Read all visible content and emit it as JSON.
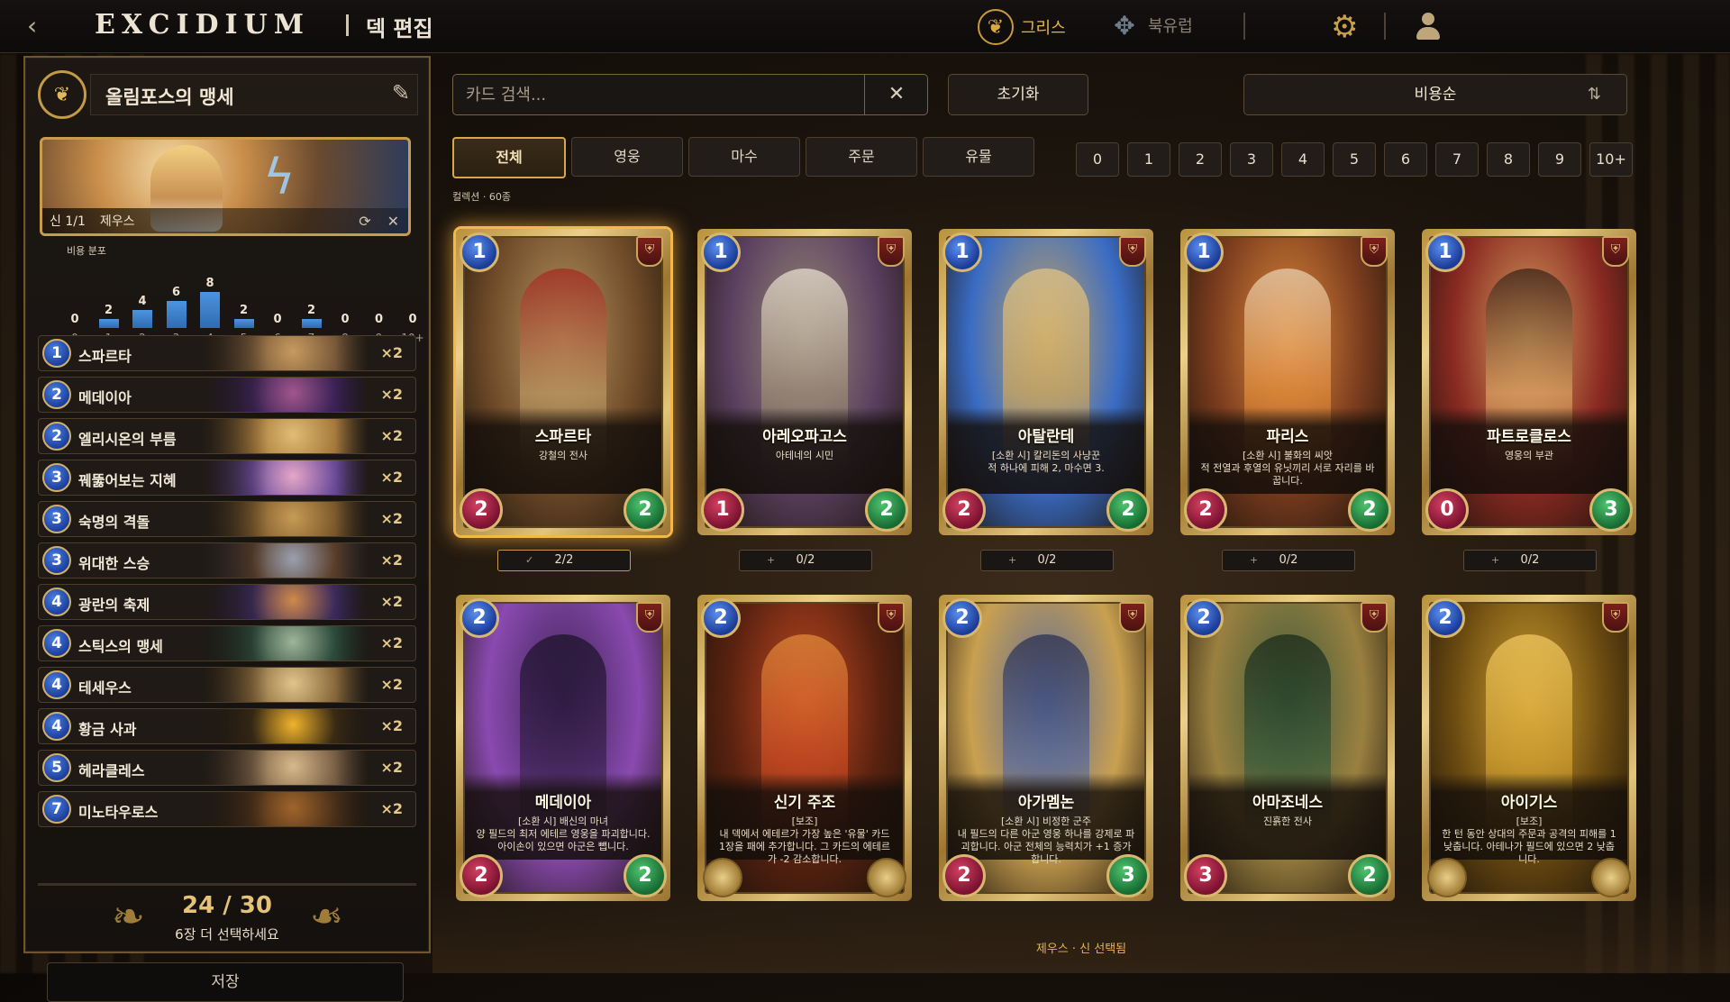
{
  "topbar": {
    "logo": "EXCIDIUM",
    "page_title": "덱 편집",
    "factions": [
      {
        "label": "그리스",
        "active": true,
        "color": "#e8b547"
      },
      {
        "label": "북유럽",
        "active": false,
        "color": "#8b8174"
      }
    ]
  },
  "deck": {
    "name": "올림포스의 맹세",
    "hero": {
      "slot": "신 1/1",
      "name": "제우스"
    },
    "cost_distribution_label": "비용 분포",
    "cost_curve": [
      {
        "cost": "0",
        "count": 0
      },
      {
        "cost": "1",
        "count": 2
      },
      {
        "cost": "2",
        "count": 4
      },
      {
        "cost": "3",
        "count": 6
      },
      {
        "cost": "4",
        "count": 8
      },
      {
        "cost": "5",
        "count": 2
      },
      {
        "cost": "6",
        "count": 0
      },
      {
        "cost": "7",
        "count": 2
      },
      {
        "cost": "8",
        "count": 0
      },
      {
        "cost": "9",
        "count": 0
      },
      {
        "cost": "10+",
        "count": 0
      }
    ],
    "cards": [
      {
        "cost": "1",
        "name": "스파르타",
        "qty": "×2",
        "art": [
          "#7a5a3a",
          "#c79a5f",
          "#3a2a1c"
        ]
      },
      {
        "cost": "2",
        "name": "메데이아",
        "qty": "×2",
        "art": [
          "#3b2257",
          "#a0568c",
          "#1d1430"
        ]
      },
      {
        "cost": "2",
        "name": "엘리시온의 부름",
        "qty": "×2",
        "art": [
          "#a77a3c",
          "#e0bd74",
          "#4b3520"
        ]
      },
      {
        "cost": "3",
        "name": "꿰뚫어보는 지혜",
        "qty": "×2",
        "art": [
          "#6b4c9a",
          "#e6a6c8",
          "#2c1f45"
        ]
      },
      {
        "cost": "3",
        "name": "숙명의 격돌",
        "qty": "×2",
        "art": [
          "#7d5a2c",
          "#c79a55",
          "#2a1e12"
        ]
      },
      {
        "cost": "3",
        "name": "위대한 스승",
        "qty": "×2",
        "art": [
          "#5a3e2a",
          "#9aa0b0",
          "#2a2a3a"
        ]
      },
      {
        "cost": "4",
        "name": "광란의 축제",
        "qty": "×2",
        "art": [
          "#3b2a5c",
          "#d08a4a",
          "#1c1630"
        ]
      },
      {
        "cost": "4",
        "name": "스틱스의 맹세",
        "qty": "×2",
        "art": [
          "#2c4a3a",
          "#9fb59a",
          "#162420"
        ]
      },
      {
        "cost": "4",
        "name": "테세우스",
        "qty": "×2",
        "art": [
          "#8a6a3c",
          "#e0c48a",
          "#3a2a18"
        ]
      },
      {
        "cost": "4",
        "name": "황금 사과",
        "qty": "×2",
        "art": [
          "#3a2a14",
          "#f0b42c",
          "#1c140a"
        ]
      },
      {
        "cost": "5",
        "name": "헤라클레스",
        "qty": "×2",
        "art": [
          "#7a6046",
          "#d7b98a",
          "#3a2c1e"
        ]
      },
      {
        "cost": "7",
        "name": "미노타우로스",
        "qty": "×2",
        "art": [
          "#4a3018",
          "#a0642c",
          "#20140a"
        ]
      }
    ],
    "count": "24 / 30",
    "hint": "6장 더 선택하세요",
    "save_label": "저장"
  },
  "filters": {
    "search_placeholder": "카드 검색...",
    "search_value": "",
    "clear_icon": "close-icon",
    "reset_label": "초기화",
    "sort_label": "비용순",
    "type_tabs": [
      {
        "label": "전체",
        "active": true
      },
      {
        "label": "영웅",
        "active": false
      },
      {
        "label": "마수",
        "active": false
      },
      {
        "label": "주문",
        "active": false
      },
      {
        "label": "유물",
        "active": false
      }
    ],
    "cost_buttons": [
      "0",
      "1",
      "2",
      "3",
      "4",
      "5",
      "6",
      "7",
      "8",
      "9",
      "10+"
    ],
    "collection_label": "컬렉션 · 60종"
  },
  "cards": [
    {
      "mana": "1",
      "name": "스파르타",
      "desc": "강철의 전사",
      "atk": "2",
      "hp": "2",
      "owned": "2/2",
      "selected": true,
      "art": [
        "#b89560",
        "#6e4a28",
        "#a32a22"
      ]
    },
    {
      "mana": "1",
      "name": "아레오파고스",
      "desc": "아테네의 시민",
      "atk": "1",
      "hp": "2",
      "owned": "0/2",
      "selected": false,
      "art": [
        "#9a8a76",
        "#5a4060",
        "#e8e0d0"
      ]
    },
    {
      "mana": "1",
      "name": "아탈란테",
      "desc": "[소환 시] 칼리돈의 사냥꾼\n적 하나에 피해 2, 마수면 3.",
      "atk": "2",
      "hp": "2",
      "owned": "0/2",
      "selected": false,
      "art": [
        "#c9a560",
        "#3a6cc4",
        "#e0c488"
      ]
    },
    {
      "mana": "1",
      "name": "파리스",
      "desc": "[소환 시] 불화의 씨앗\n적 전열과 후열의 유닛끼리 서로 자리를 바꿉니다.",
      "atk": "2",
      "hp": "2",
      "owned": "0/2",
      "selected": false,
      "art": [
        "#e08a3a",
        "#7a3c1e",
        "#e8d0b0"
      ]
    },
    {
      "mana": "1",
      "name": "파트로클로스",
      "desc": "영웅의 부관",
      "atk": "0",
      "hp": "3",
      "owned": "0/2",
      "selected": false,
      "art": [
        "#d8a060",
        "#8a2a22",
        "#3a2418"
      ]
    },
    {
      "mana": "2",
      "name": "메데이아",
      "desc": "[소환 시] 배신의 마녀\n양 필드의 최저 에테르 영웅을 파괴합니다. 아이손이 있으면 아군은 뺍니다.",
      "atk": "2",
      "hp": "2",
      "owned": "",
      "selected": false,
      "art": [
        "#3a2250",
        "#8a4ab0",
        "#1c1228"
      ]
    },
    {
      "mana": "2",
      "name": "신기 주조",
      "desc": "[보조]\n내 덱에서 에테르가 가장 높은 '유물' 카드 1장을 패에 추가합니다. 그 카드의 에테르가 -2 감소합니다.",
      "atk": "",
      "hp": "",
      "owned": "",
      "selected": false,
      "art": [
        "#c84a22",
        "#5a2210",
        "#e08a3a"
      ]
    },
    {
      "mana": "2",
      "name": "아가멤논",
      "desc": "[소환 시] 비정한 군주\n내 필드의 다른 아군 영웅 하나를 강제로 파괴합니다. 아군 전체의 능력치가 +1 증가합니다.",
      "atk": "2",
      "hp": "3",
      "owned": "",
      "selected": false,
      "art": [
        "#5a6a9a",
        "#c9a050",
        "#2a3050"
      ]
    },
    {
      "mana": "2",
      "name": "아마조네스",
      "desc": "진흙한 전사",
      "atk": "3",
      "hp": "2",
      "owned": "",
      "selected": false,
      "art": [
        "#3a5a3a",
        "#9a8040",
        "#1a2a1a"
      ]
    },
    {
      "mana": "2",
      "name": "아이기스",
      "desc": "[보조]\n한 턴 동안 상대의 주문과 공격의 피해를 1 낮춥니다. 아테나가 필드에 있으면 2 낮춥니다.",
      "atk": "",
      "hp": "",
      "owned": "",
      "selected": false,
      "art": [
        "#d0a030",
        "#6a4a10",
        "#f0c860"
      ]
    }
  ],
  "footer": "제우스 · 신 선택됨"
}
